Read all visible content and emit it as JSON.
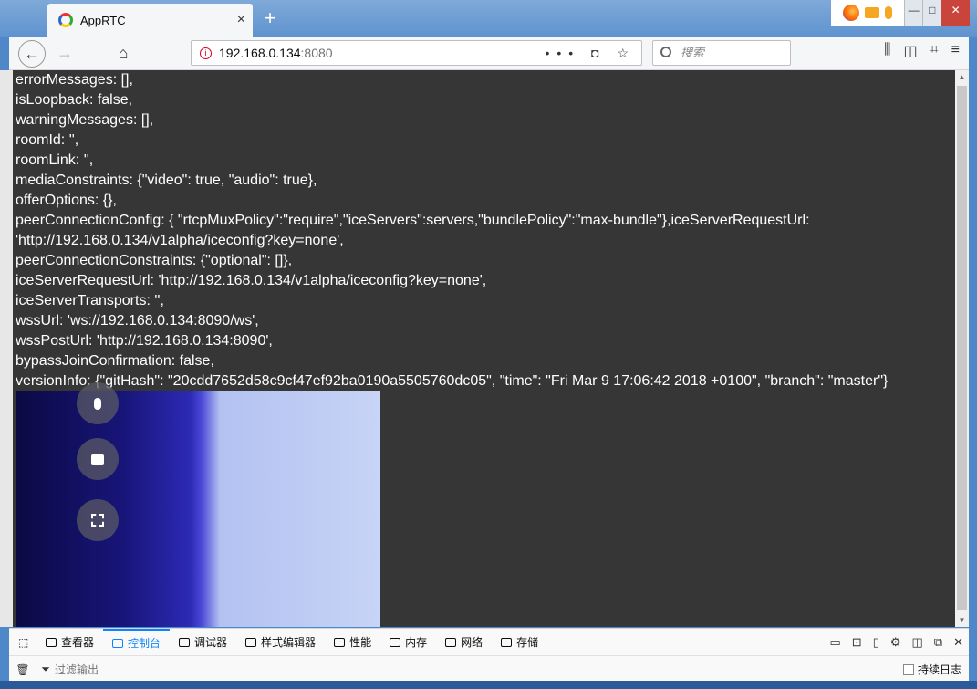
{
  "tab": {
    "title": "AppRTC",
    "close": "×",
    "new_tab": "+"
  },
  "nav": {
    "back": "←",
    "forward": "→",
    "home": "⌂",
    "url_host": "192.168.0.134",
    "url_port": ":8080",
    "url_actions": "••• ◘ ☆",
    "search_placeholder": "搜索"
  },
  "window_buttons": [
    "—",
    "□",
    "✕"
  ],
  "log_lines": [
    "errorMessages: [],",
    "isLoopback: false,",
    "warningMessages: [],",
    "roomId: '',",
    "roomLink: '',",
    "mediaConstraints: {\"video\": true, \"audio\": true},",
    "offerOptions: {},",
    "peerConnectionConfig: { \"rtcpMuxPolicy\":\"require\",\"iceServers\":servers,\"bundlePolicy\":\"max-bundle\"},iceServerRequestUrl:",
    "'http://192.168.0.134/v1alpha/iceconfig?key=none',",
    "peerConnectionConstraints: {\"optional\": []},",
    "iceServerRequestUrl: 'http://192.168.0.134/v1alpha/iceconfig?key=none',",
    "iceServerTransports: '',",
    "wssUrl: 'ws://192.168.0.134:8090/ws',",
    "wssPostUrl: 'http://192.168.0.134:8090',",
    "bypassJoinConfirmation: false,",
    "versionInfo: {\"gitHash\": \"20cdd7652d58c9cf47ef92ba0190a5505760dc05\", \"time\": \"Fri Mar 9 17:06:42 2018 +0100\", \"branch\": \"master\"}"
  ],
  "devtools": {
    "tabs": [
      {
        "label": "查看器",
        "active": false
      },
      {
        "label": "控制台",
        "active": true
      },
      {
        "label": "调试器",
        "active": false
      },
      {
        "label": "样式编辑器",
        "active": false
      },
      {
        "label": "性能",
        "active": false
      },
      {
        "label": "内存",
        "active": false
      },
      {
        "label": "网络",
        "active": false
      },
      {
        "label": "存储",
        "active": false
      }
    ],
    "filter_placeholder": "过滤输出",
    "persist_logs": "持续日志"
  },
  "colors": {
    "accent": "#0a84ff",
    "content_bg": "#363636"
  }
}
